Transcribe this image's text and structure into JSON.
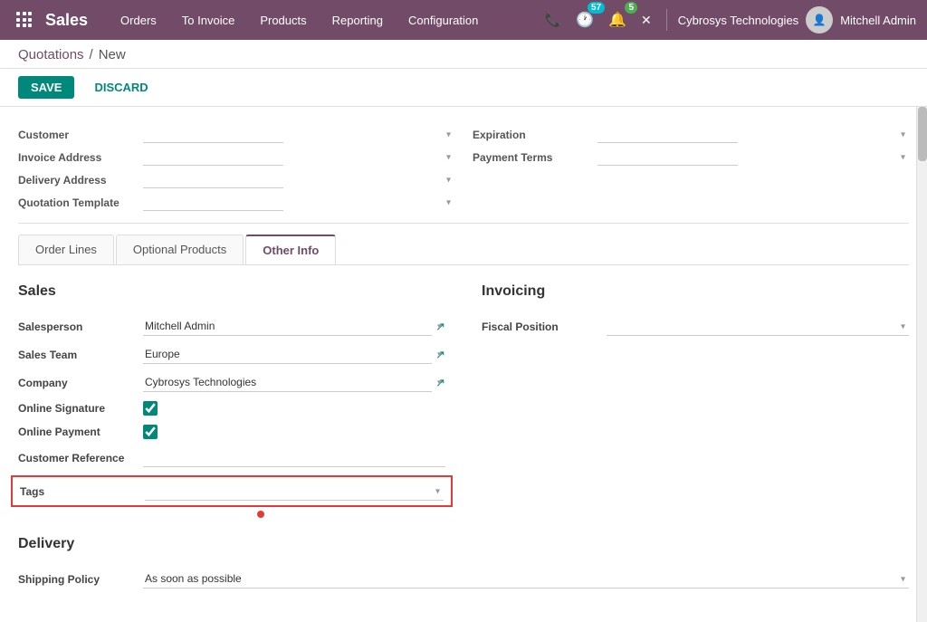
{
  "topnav": {
    "brand": "Sales",
    "menu": [
      "Orders",
      "To Invoice",
      "Products",
      "Reporting",
      "Configuration"
    ],
    "clock_badge": "57",
    "bell_badge": "5",
    "company": "Cybrosys Technologies",
    "user": "Mitchell Admin"
  },
  "breadcrumb": {
    "parent": "Quotations",
    "separator": "/",
    "current": "New"
  },
  "actions": {
    "save": "SAVE",
    "discard": "DISCARD"
  },
  "form_top": {
    "left": [
      {
        "label": "Customer",
        "value": ""
      },
      {
        "label": "Invoice Address",
        "value": ""
      },
      {
        "label": "Delivery Address",
        "value": ""
      },
      {
        "label": "Quotation Template",
        "value": ""
      }
    ],
    "right": [
      {
        "label": "Expiration",
        "value": ""
      },
      {
        "label": "Payment Terms",
        "value": ""
      }
    ]
  },
  "tabs": {
    "items": [
      "Order Lines",
      "Optional Products",
      "Other Info"
    ],
    "active": "Other Info"
  },
  "sales_section": {
    "title": "Sales",
    "fields": [
      {
        "id": "salesperson",
        "label": "Salesperson",
        "value": "Mitchell Admin",
        "has_link": true
      },
      {
        "id": "sales_team",
        "label": "Sales Team",
        "value": "Europe",
        "has_link": true
      },
      {
        "id": "company",
        "label": "Company",
        "value": "Cybrosys Technologies",
        "has_link": true
      },
      {
        "id": "online_signature",
        "label": "Online Signature",
        "value": "checked",
        "type": "checkbox"
      },
      {
        "id": "online_payment",
        "label": "Online Payment",
        "value": "checked",
        "type": "checkbox"
      },
      {
        "id": "customer_reference",
        "label": "Customer Reference",
        "value": "",
        "type": "text"
      },
      {
        "id": "tags",
        "label": "Tags",
        "value": "",
        "type": "tags",
        "highlighted": true
      }
    ]
  },
  "invoicing_section": {
    "title": "Invoicing",
    "fields": [
      {
        "id": "fiscal_position",
        "label": "Fiscal Position",
        "value": ""
      }
    ]
  },
  "delivery_section": {
    "title": "Delivery",
    "fields": [
      {
        "id": "shipping_policy",
        "label": "Shipping Policy",
        "value": "As soon as possible"
      }
    ]
  }
}
